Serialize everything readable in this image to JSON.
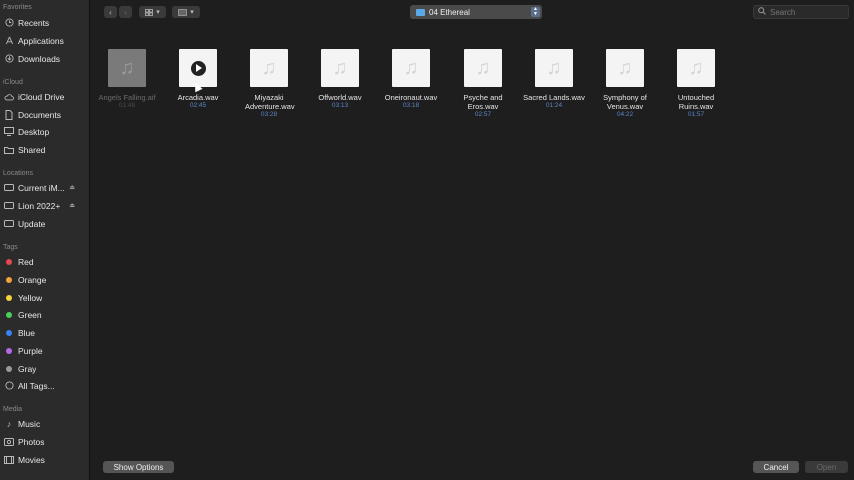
{
  "sidebar": {
    "sections": {
      "favorites": "Favorites",
      "icloud": "iCloud",
      "locations": "Locations",
      "tags": "Tags",
      "media": "Media"
    },
    "favorites": [
      {
        "label": "Recents",
        "icon": "clock-icon"
      },
      {
        "label": "Applications",
        "icon": "applications-icon"
      },
      {
        "label": "Downloads",
        "icon": "download-icon"
      }
    ],
    "icloud": [
      {
        "label": "iCloud Drive",
        "icon": "cloud-icon"
      },
      {
        "label": "Documents",
        "icon": "document-icon"
      },
      {
        "label": "Desktop",
        "icon": "desktop-icon"
      },
      {
        "label": "Shared",
        "icon": "shared-folder-icon"
      }
    ],
    "locations": [
      {
        "label": "Current iM...",
        "icon": "disk-icon"
      },
      {
        "label": "Lion 2022+",
        "icon": "disk-icon"
      },
      {
        "label": "Update",
        "icon": "disk-icon"
      }
    ],
    "tags": [
      {
        "label": "Red",
        "color": "#e5484d"
      },
      {
        "label": "Orange",
        "color": "#f2a33a"
      },
      {
        "label": "Yellow",
        "color": "#f5d33a"
      },
      {
        "label": "Green",
        "color": "#4ccf5a"
      },
      {
        "label": "Blue",
        "color": "#3b82f6"
      },
      {
        "label": "Purple",
        "color": "#b36ae2"
      },
      {
        "label": "Gray",
        "color": "#9a9a9a"
      },
      {
        "label": "All Tags...",
        "color": ""
      }
    ],
    "media": [
      {
        "label": "Music",
        "icon": "music-icon"
      },
      {
        "label": "Photos",
        "icon": "photos-icon"
      },
      {
        "label": "Movies",
        "icon": "movies-icon"
      }
    ]
  },
  "toolbar": {
    "path": "04 Ethereal",
    "search_placeholder": "Search"
  },
  "files": [
    {
      "name": "Angels Falling.aif",
      "duration": "01:48",
      "dimmed": true
    },
    {
      "name": "Arcadia.wav",
      "duration": "02:45",
      "playing": true
    },
    {
      "name": "Miyazaki Adventure.wav",
      "duration": "03:28"
    },
    {
      "name": "Offworld.wav",
      "duration": "03:13"
    },
    {
      "name": "Oneironaut.wav",
      "duration": "03:18"
    },
    {
      "name": "Psyche and Eros.wav",
      "duration": "02:57"
    },
    {
      "name": "Sacred Lands.wav",
      "duration": "01:24"
    },
    {
      "name": "Symphony of Venus.wav",
      "duration": "04:22"
    },
    {
      "name": "Untouched Ruins.wav",
      "duration": "01:57"
    }
  ],
  "footer": {
    "show_options": "Show Options",
    "cancel": "Cancel",
    "open": "Open"
  }
}
